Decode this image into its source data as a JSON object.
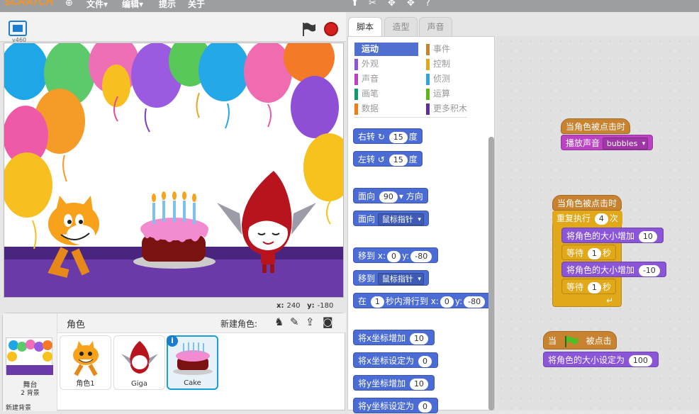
{
  "topbar": {
    "logo": "SCRATCH",
    "menus": [
      "文件▾",
      "编辑▾",
      "提示",
      "关于"
    ]
  },
  "stage": {
    "version": "v460",
    "coords": {
      "x_label": "x:",
      "x_value": "240",
      "y_label": "y:",
      "y_value": "-180"
    }
  },
  "sprites": {
    "header": "角色",
    "new_sprite_label": "新建角色:",
    "stage_label": "舞台",
    "stage_backdrops": "2 背景",
    "new_backdrop_label": "新建背景",
    "items": [
      {
        "name": "角色1"
      },
      {
        "name": "Giga"
      },
      {
        "name": "Cake"
      }
    ]
  },
  "tabs": [
    "脚本",
    "造型",
    "声音"
  ],
  "categories": {
    "left": [
      "运动",
      "外观",
      "声音",
      "画笔",
      "数据"
    ],
    "right": [
      "事件",
      "控制",
      "侦测",
      "运算",
      "更多积木"
    ],
    "colors_left": [
      "#4a6cd4",
      "#8a55d7",
      "#bb42c3",
      "#0e9a6c",
      "#ee7d16"
    ],
    "colors_right": [
      "#c88330",
      "#e1a91a",
      "#2ca5e2",
      "#5cb712",
      "#632d99"
    ]
  },
  "palette": {
    "turn_right": {
      "label": "右转",
      "value": "15",
      "unit": "度"
    },
    "turn_left": {
      "label": "左转",
      "value": "15",
      "unit": "度"
    },
    "point_dir": {
      "label": "面向",
      "value": "90",
      "unit": "方向"
    },
    "point_towards": {
      "label": "面向",
      "option": "鼠标指针"
    },
    "goto_xy": {
      "label": "移到",
      "x_label": "x:",
      "x": "0",
      "y_label": "y:",
      "y": "-80"
    },
    "goto": {
      "label": "移到",
      "option": "鼠标指针"
    },
    "glide": {
      "label1": "在",
      "secs": "1",
      "label2": "秒内滑行到",
      "x_label": "x:",
      "x": "0",
      "y_label": "y:",
      "y": "-80"
    },
    "change_x": {
      "label": "将x坐标增加",
      "value": "10"
    },
    "set_x": {
      "label": "将x坐标设定为",
      "value": "0"
    },
    "change_y": {
      "label": "将y坐标增加",
      "value": "10"
    },
    "set_y": {
      "label": "将y坐标设定为",
      "value": "0"
    }
  },
  "scripts": {
    "s1_hat": "当角色被点击时",
    "s1_sound": {
      "label": "播放声音",
      "option": "bubbles"
    },
    "s2_hat": "当角色被点击时",
    "s2_repeat": {
      "label": "重复执行",
      "value": "4",
      "unit": "次"
    },
    "s2_change1": {
      "label": "将角色的大小增加",
      "value": "10"
    },
    "s2_wait1": {
      "label": "等待",
      "value": "1",
      "unit": "秒"
    },
    "s2_change2": {
      "label": "将角色的大小增加",
      "value": "-10"
    },
    "s2_wait2": {
      "label": "等待",
      "value": "1",
      "unit": "秒"
    },
    "s3_hat_a": "当",
    "s3_hat_b": "被点击",
    "s3_set": {
      "label": "将角色的大小设定为",
      "value": "100"
    }
  }
}
